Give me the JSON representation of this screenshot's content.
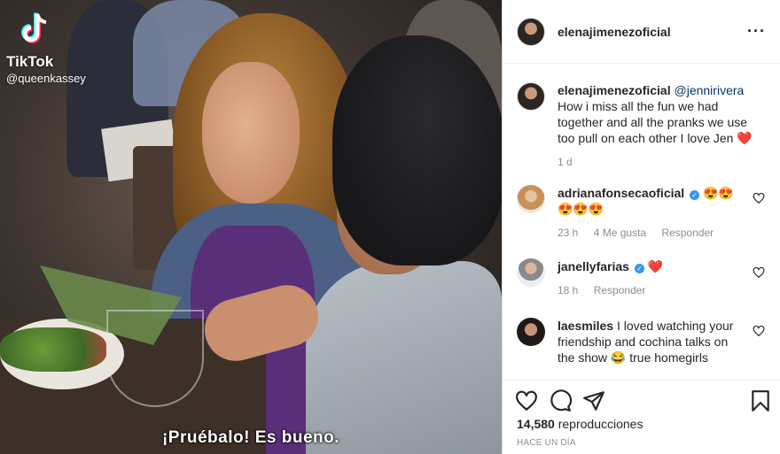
{
  "video": {
    "tiktok_label": "TikTok",
    "tiktok_handle": "@queenkassey",
    "subtitle": "¡Pruébalo! Es bueno."
  },
  "post": {
    "owner": "elenajimenezoficial",
    "more_label": "···",
    "caption": {
      "user": "elenajimenezoficial",
      "mention": "@jennirivera",
      "text": " How i miss all the fun we had together and all the pranks we use too pull on each other I love Jen ",
      "emoji": "❤️",
      "time": "1 d"
    },
    "comments": [
      {
        "user": "adrianafonsecaoficial",
        "verified": true,
        "text": "😍😍😍😍😍",
        "time": "23 h",
        "likes": "4 Me gusta",
        "reply": "Responder"
      },
      {
        "user": "janellyfarias",
        "verified": true,
        "text": "❤️",
        "time": "18 h",
        "likes": "",
        "reply": "Responder"
      },
      {
        "user": "laesmiles",
        "verified": false,
        "text": "I loved watching your friendship and cochina talks on the show 😂 true homegirls",
        "time": "",
        "likes": "",
        "reply": ""
      }
    ],
    "views_count": "14,580",
    "views_label": "reproducciones",
    "timestamp": "HACE UN DÍA"
  },
  "icons": [
    "tiktok-logo-icon",
    "more-options-icon",
    "heart-icon",
    "comment-icon",
    "share-icon",
    "bookmark-icon",
    "verified-badge-icon"
  ]
}
